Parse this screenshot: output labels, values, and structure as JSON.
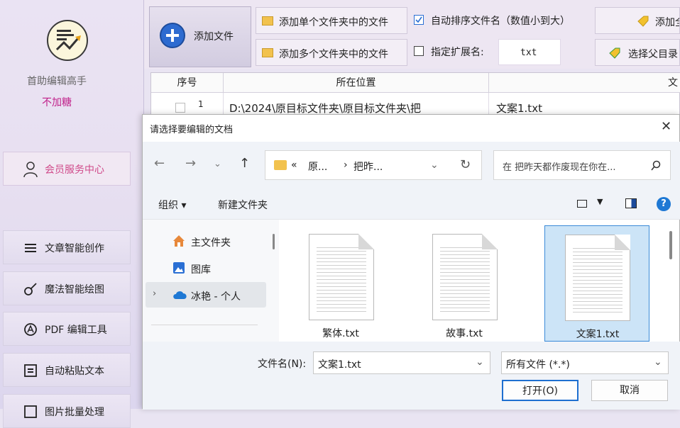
{
  "sidebar": {
    "app_name": "首助编辑高手",
    "subtitle": "不加糖",
    "member_center": "会员服务中心",
    "items": [
      {
        "label": "文章智能创作"
      },
      {
        "label": "魔法智能绘图"
      },
      {
        "label": "PDF 编辑工具"
      },
      {
        "label": "自动粘贴文本"
      },
      {
        "label": "图片批量处理"
      }
    ]
  },
  "toolbar": {
    "add_file": "添加文件",
    "add_single_folder": "添加单个文件夹中的文件",
    "add_multi_folder": "添加多个文件夹中的文件",
    "auto_sort_label": "自动排序文件名（数值小到大）",
    "auto_sort_checked": true,
    "ext_label": "指定扩展名:",
    "ext_checked": false,
    "ext_value": "txt",
    "add_all_partial": "添加全",
    "select_parent_partial": "选择父目录"
  },
  "table": {
    "headers": [
      "序号",
      "所在位置",
      "文"
    ],
    "rows": [
      {
        "index": "1",
        "path": "D:\\2024\\原目标文件夹\\原目标文件夹\\把",
        "name": "文案1.txt"
      }
    ]
  },
  "dialog": {
    "title": "请选择要编辑的文档",
    "breadcrumb": [
      "原...",
      "把昨..."
    ],
    "breadcrumb_prefix": "«",
    "search_placeholder": "在 把昨天都作废现在你在...",
    "organize": "组织 ▾",
    "new_folder": "新建文件夹",
    "nav": [
      {
        "label": "主文件夹"
      },
      {
        "label": "图库"
      },
      {
        "label": "冰艳 - 个人"
      }
    ],
    "files": [
      {
        "name": "繁体.txt",
        "selected": false
      },
      {
        "name": "故事.txt",
        "selected": false
      },
      {
        "name": "文案1.txt",
        "selected": true
      }
    ],
    "filename_label": "文件名(N):",
    "filename_value": "文案1.txt",
    "filetype_value": "所有文件 (*.*)",
    "open_button": "打开(O)",
    "cancel_button": "取消"
  },
  "colors": {
    "accent_pink": "#d04a8a",
    "selection_blue": "#cce4f7",
    "primary_blue": "#2d6bd0"
  }
}
